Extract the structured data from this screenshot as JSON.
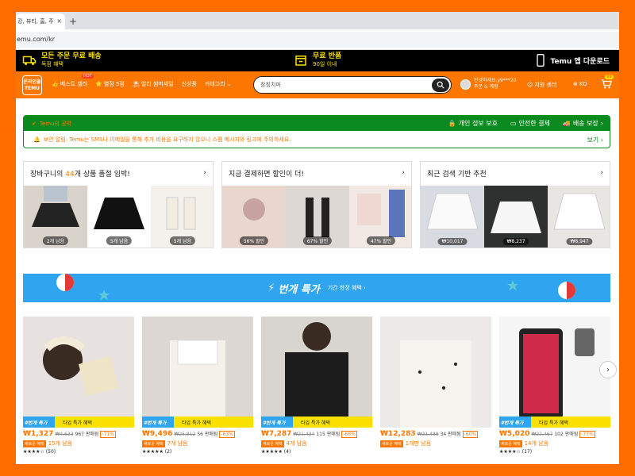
{
  "browser": {
    "tab_title": "강, 뷰티, 홈, 주",
    "tab_close": "×",
    "new_tab": "+",
    "url": "emu.com/kr"
  },
  "promo": {
    "free_shipping_main": "모든 주문 무료 배송",
    "free_shipping_sub": "독점 혜택",
    "free_return_main": "무료 반품",
    "free_return_sub": "90일 이내",
    "app_download": "Temu 앱 다운로드"
  },
  "nav": {
    "logo_line1": "온라인몰",
    "logo_line2": "TEMU",
    "items": [
      "베스트 셀러",
      "별점 5점",
      "얼리 썸머세일",
      "신상품",
      "카테고리"
    ],
    "hot": "HOT",
    "category_caret": "⌄",
    "search_placeholder": "창칭치마",
    "account_line1": "안녕하세요,y9***20",
    "account_line2": "주문 & 계정",
    "support": "지원 센터",
    "lang": "KO",
    "cart_count": "99"
  },
  "commitment": {
    "title": "Temu의 공약",
    "privacy": "개인 정보 보호",
    "safe_pay": "안전한 결제",
    "delivery": "배송 보장",
    "alert": "보안 알림: Temu는 SMS나 이메일을 통해 추가 비용을 요구하지 않으니 스팸 메시지와 링크에 주의하세요.",
    "more": "보기",
    "chevron": "›"
  },
  "cards": [
    {
      "title_pre": "장바구니의 ",
      "title_hl": "44",
      "title_post": "개 상품 품절 임박!",
      "pills": [
        "2개 남음",
        "5개 남음",
        "5개 남음"
      ]
    },
    {
      "title_pre": "지금 결제하면 할인이 더!",
      "title_hl": "",
      "title_post": "",
      "pills": [
        "56% 할인",
        "67% 할인",
        "47% 할인"
      ]
    },
    {
      "title_pre": "최근 검색 기반 추천",
      "title_hl": "",
      "title_post": "",
      "pills": [
        "₩10,017",
        "₩8,237",
        "₩8,947"
      ]
    }
  ],
  "card_chevron": "›",
  "banner": {
    "title": "번개 특가",
    "sub": "기간 한정 혜택 ›"
  },
  "flash_label": "#번개 특가",
  "flash_sub": "타임 특가 혜택",
  "new_badge": "새로운 혜택",
  "products": [
    {
      "price": "₩1,327",
      "orig": "₩4,633",
      "sold": "967 판매됨",
      "disc": "-71%",
      "left": "15개 남음",
      "rating": "★★★★☆ (50)"
    },
    {
      "price": "₩9,496",
      "orig": "₩25,812",
      "sold": "56 판매됨",
      "disc": "-63%",
      "left": "7개 남음",
      "rating": "★★★★★ (2)"
    },
    {
      "price": "₩7,287",
      "orig": "₩21,434",
      "sold": "115 판매됨",
      "disc": "-66%",
      "left": "4개 남음",
      "rating": "★★★★★ (4)"
    },
    {
      "price": "₩12,283",
      "orig": "₩31,488",
      "sold": "34 판매됨",
      "disc": "-60%",
      "left": "1개만 남음",
      "rating": ""
    },
    {
      "price": "₩5,020",
      "orig": "₩22,467",
      "sold": "102 판매됨",
      "disc": "-77%",
      "left": "14개 남음",
      "rating": "★★★★☆ (17)"
    }
  ],
  "next_arrow": "›"
}
